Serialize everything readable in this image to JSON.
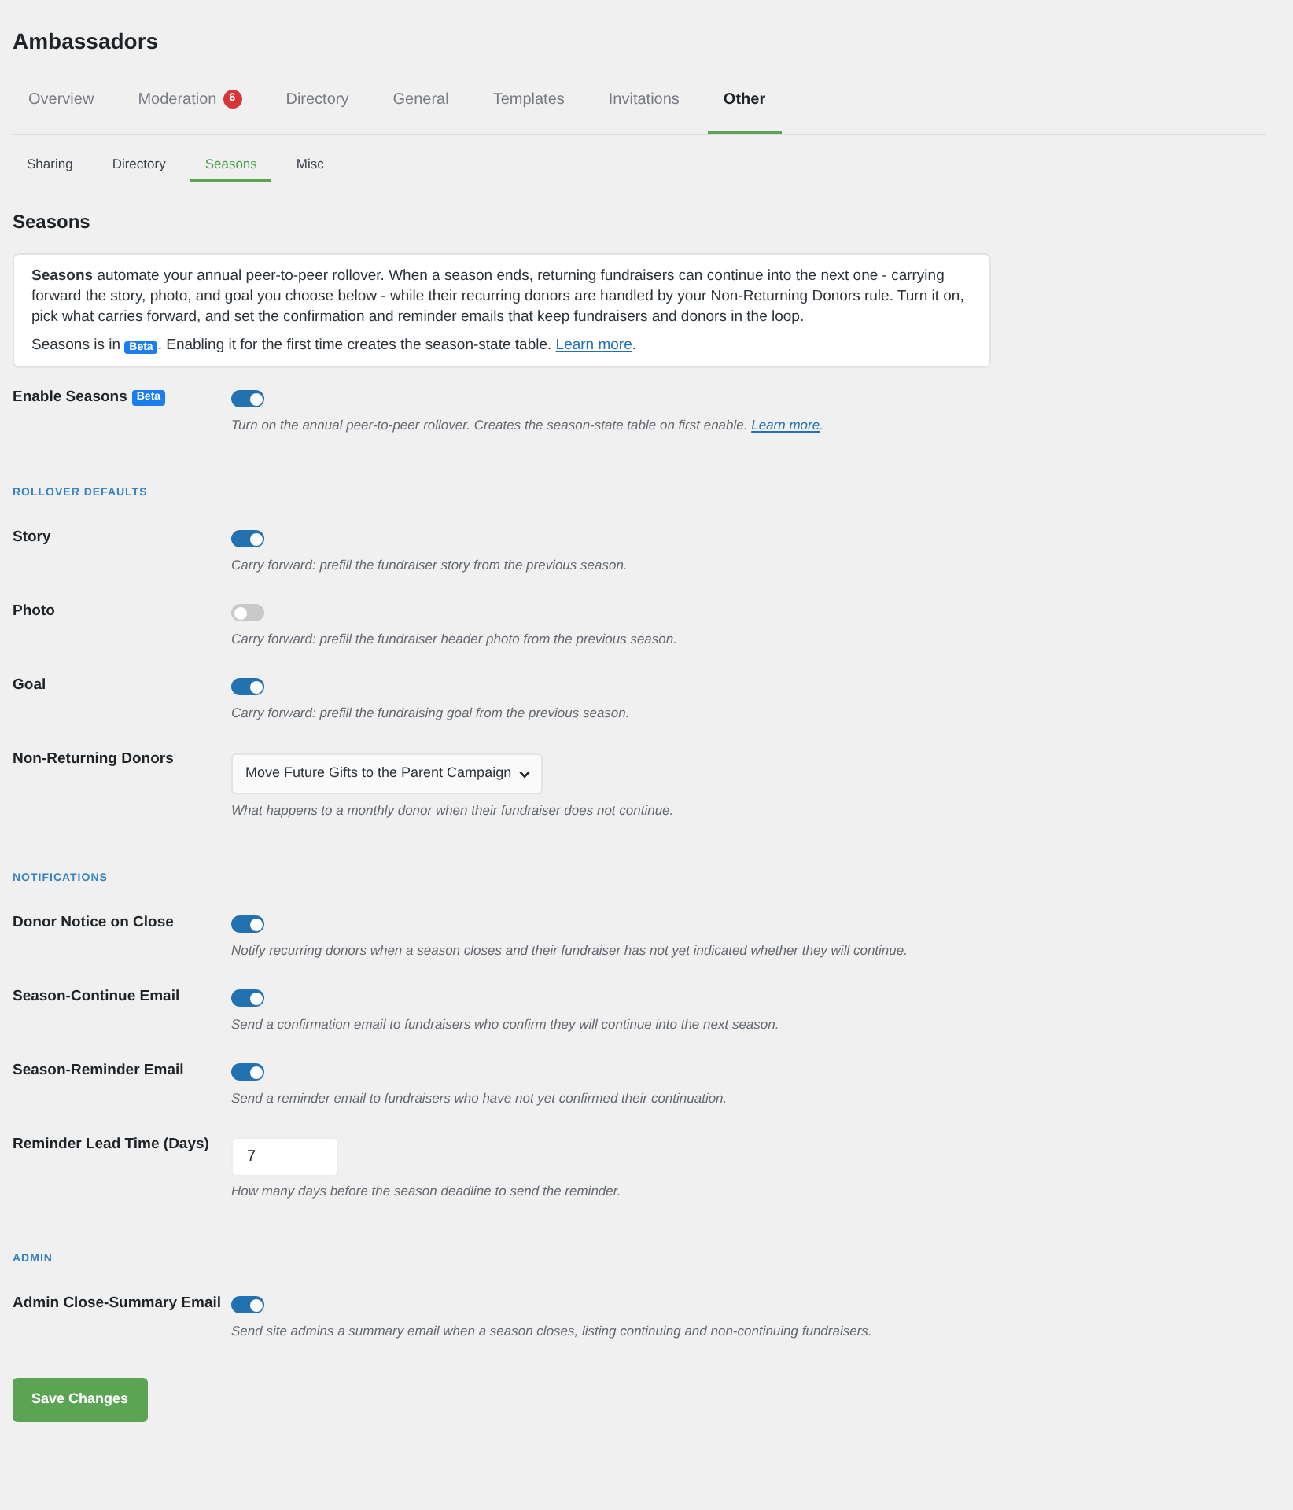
{
  "page": {
    "title": "Ambassadors"
  },
  "tabs": [
    {
      "label": "Overview",
      "selected": false
    },
    {
      "label": "Moderation",
      "badge": "6",
      "selected": false
    },
    {
      "label": "Directory",
      "selected": false
    },
    {
      "label": "General",
      "selected": false
    },
    {
      "label": "Templates",
      "selected": false
    },
    {
      "label": "Invitations",
      "selected": false
    },
    {
      "label": "Other",
      "selected": true
    }
  ],
  "subtabs": [
    {
      "label": "Sharing",
      "selected": false
    },
    {
      "label": "Directory",
      "selected": false
    },
    {
      "label": "Seasons",
      "selected": true
    },
    {
      "label": "Misc",
      "selected": false
    }
  ],
  "heading": "Seasons",
  "intro": {
    "text": "**Seasons** automate your annual peer-to-peer rollover. When a season ends, returning fundraisers can continue into the next one - carrying forward the story, photo, and goal you choose below - while their recurring donors are handled by your Non-Returning Donors rule. Turn it on, pick what carries forward, and set the confirmation and reminder emails that keep fundraisers and donors in the loop.",
    "note_before": "Seasons is in",
    "note_badge": "Beta",
    "note_after": ". Enabling it for the first time creates the season-state table.",
    "note_link": "Learn more",
    "note_end": "."
  },
  "enable": {
    "label": "Enable Seasons",
    "badge": "Beta",
    "on": true,
    "description": "Turn on the annual peer-to-peer rollover. Creates the season-state table on first enable.",
    "link": "Learn more",
    "description_end": "."
  },
  "sections": [
    {
      "heading": "ROLLOVER DEFAULTS",
      "rows": [
        {
          "kind": "toggle",
          "label": "Story",
          "on": true,
          "description": "Carry forward: prefill the fundraiser story from the previous season."
        },
        {
          "kind": "toggle",
          "label": "Photo",
          "on": false,
          "description": "Carry forward: prefill the fundraiser header photo from the previous season."
        },
        {
          "kind": "toggle",
          "label": "Goal",
          "on": true,
          "description": "Carry forward: prefill the fundraising goal from the previous season."
        },
        {
          "kind": "select",
          "label": "Non-Returning Donors",
          "value": "Move Future Gifts to the Parent Campaign",
          "description": "What happens to a monthly donor when their fundraiser does not continue."
        }
      ]
    },
    {
      "heading": "NOTIFICATIONS",
      "rows": [
        {
          "kind": "toggle",
          "label": "Donor Notice on Close",
          "on": true,
          "description": "Notify recurring donors when a season closes and their fundraiser has not yet indicated whether they will continue."
        },
        {
          "kind": "toggle",
          "label": "Season-Continue Email",
          "on": true,
          "description": "Send a confirmation email to fundraisers who confirm they will continue into the next season."
        },
        {
          "kind": "toggle",
          "label": "Season-Reminder Email",
          "on": true,
          "description": "Send a reminder email to fundraisers who have not yet confirmed their continuation."
        },
        {
          "kind": "number",
          "label": "Reminder Lead Time (Days)",
          "value": "7",
          "description": "How many days before the season deadline to send the reminder."
        }
      ]
    },
    {
      "heading": "ADMIN",
      "rows": [
        {
          "kind": "toggle",
          "label": "Admin Close-Summary Email",
          "on": true,
          "description": "Send site admins a summary email when a season closes, listing continuing and non-continuing fundraisers."
        }
      ]
    }
  ],
  "save_button": "Save Changes"
}
